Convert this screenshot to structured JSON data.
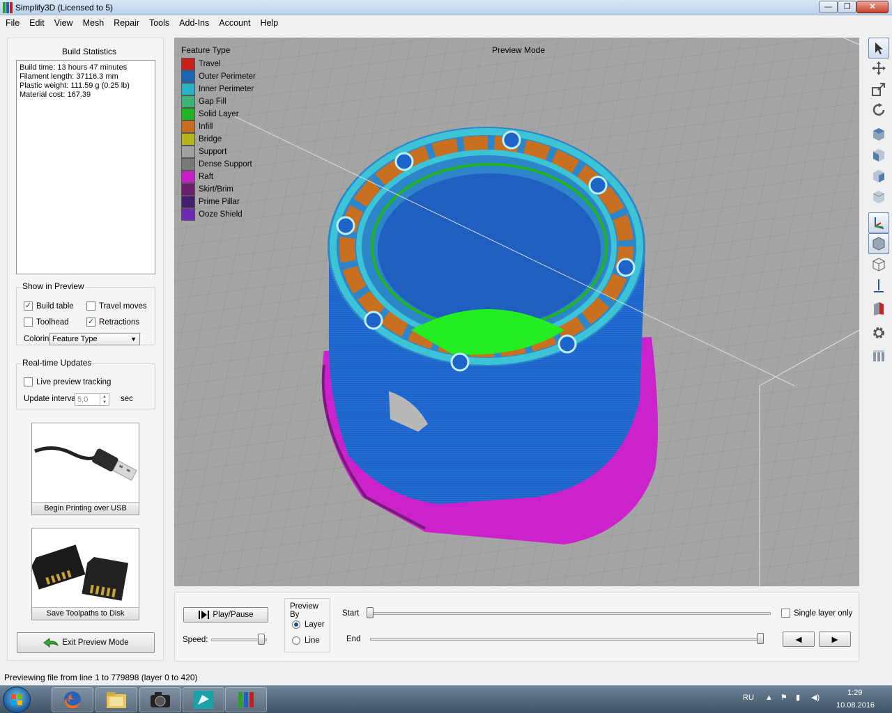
{
  "window": {
    "title": "Simplify3D (Licensed to 5)",
    "controls": {
      "minimize": "—",
      "maximize": "❐",
      "close": "✕"
    }
  },
  "menu": [
    "File",
    "Edit",
    "View",
    "Mesh",
    "Repair",
    "Tools",
    "Add-Ins",
    "Account",
    "Help"
  ],
  "build_stats": {
    "title": "Build Statistics",
    "lines": [
      "Build time: 13 hours 47 minutes",
      "Filament length: 37116.3 mm",
      "Plastic weight: 111.59 g (0.25 lb)",
      "Material cost: 167.39"
    ]
  },
  "show_in_preview": {
    "title": "Show in Preview",
    "build_table": {
      "label": "Build table",
      "checked": true
    },
    "travel_moves": {
      "label": "Travel moves",
      "checked": false
    },
    "toolhead": {
      "label": "Toolhead",
      "checked": false
    },
    "retractions": {
      "label": "Retractions",
      "checked": true
    },
    "coloring_label": "Coloring",
    "coloring_value": "Feature Type"
  },
  "realtime": {
    "title": "Real-time Updates",
    "live_label": "Live preview tracking",
    "live_checked": false,
    "interval_label": "Update interval",
    "interval_value": "5,0",
    "interval_unit": "sec"
  },
  "buttons": {
    "usb": "Begin Printing over USB",
    "disk": "Save Toolpaths to Disk",
    "exit": "Exit Preview Mode",
    "play": "Play/Pause",
    "prev": "◀",
    "next": "▶"
  },
  "viewport": {
    "legend_title": "Feature Type",
    "mode_label": "Preview Mode",
    "legend": [
      {
        "label": "Travel",
        "color": "#c8201c"
      },
      {
        "label": "Outer Perimeter",
        "color": "#1f64b4"
      },
      {
        "label": "Inner Perimeter",
        "color": "#28b4c8"
      },
      {
        "label": "Gap Fill",
        "color": "#3cb478"
      },
      {
        "label": "Solid Layer",
        "color": "#22b422"
      },
      {
        "label": "Infill",
        "color": "#c86e1e"
      },
      {
        "label": "Bridge",
        "color": "#b4b41e"
      },
      {
        "label": "Support",
        "color": "#a0a0a0"
      },
      {
        "label": "Dense Support",
        "color": "#787878"
      },
      {
        "label": "Raft",
        "color": "#c81ec8"
      },
      {
        "label": "Skirt/Brim",
        "color": "#6e1e6e"
      },
      {
        "label": "Prime Pillar",
        "color": "#461e6e"
      },
      {
        "label": "Ooze Shield",
        "color": "#6e28b4"
      }
    ]
  },
  "toolbar_icons": [
    "pointer-icon",
    "move-icon",
    "scale-icon",
    "rotate-icon",
    "view-top-icon",
    "view-front-icon",
    "view-side-icon",
    "view-iso-icon",
    "axes-icon",
    "solid-view-icon",
    "wireframe-icon",
    "z-axis-icon",
    "section-icon",
    "settings-gear-icon",
    "layers-icon"
  ],
  "preview_controls": {
    "speed_label": "Speed:",
    "speed_fraction": 0.9,
    "preview_by_title": "Preview By",
    "layer_label": "Layer",
    "line_label": "Line",
    "preview_by_selected": "Layer",
    "start_label": "Start",
    "end_label": "End",
    "start_fraction": 0.0,
    "end_fraction": 1.0,
    "single_layer_label": "Single layer only",
    "single_layer_checked": false
  },
  "status": "Previewing file from line 1 to 779898 (layer 0 to 420)",
  "taskbar": {
    "apps": [
      "firefox-icon",
      "file-explorer-icon",
      "camera-icon",
      "3dsmax-icon",
      "simplify3d-icon"
    ],
    "lang": "RU",
    "time": "1:29",
    "date": "10.08.2016"
  }
}
